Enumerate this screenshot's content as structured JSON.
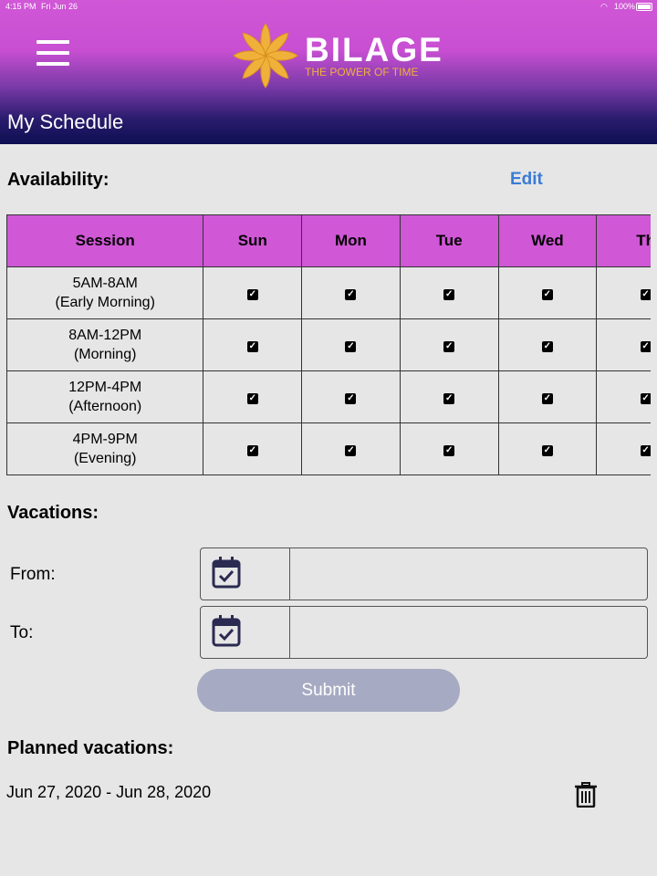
{
  "status_bar": {
    "time": "4:15 PM",
    "date": "Fri Jun 26",
    "battery": "100%"
  },
  "header": {
    "brand_name": "BILAGE",
    "brand_tagline": "THE POWER OF TIME",
    "page_title": "My Schedule",
    "menu_icon": "hamburger-icon"
  },
  "colors": {
    "header_top": "#d057d6",
    "header_bottom": "#0e0f52",
    "table_header": "#d057d6",
    "edit_link": "#3a7bd5",
    "submit_disabled": "#a6aac2",
    "brand_gold": "#f0b13a"
  },
  "availability": {
    "title": "Availability:",
    "edit_label": "Edit",
    "columns": [
      "Session",
      "Sun",
      "Mon",
      "Tue",
      "Wed",
      "Th"
    ],
    "rows": [
      {
        "line1": "5AM-8AM",
        "line2": "(Early Morning)",
        "checked": [
          true,
          true,
          true,
          true,
          true
        ]
      },
      {
        "line1": "8AM-12PM",
        "line2": "(Morning)",
        "checked": [
          true,
          true,
          true,
          true,
          true
        ]
      },
      {
        "line1": "12PM-4PM",
        "line2": "(Afternoon)",
        "checked": [
          true,
          true,
          true,
          true,
          true
        ]
      },
      {
        "line1": "4PM-9PM",
        "line2": "(Evening)",
        "checked": [
          true,
          true,
          true,
          true,
          true
        ]
      }
    ]
  },
  "vacations": {
    "title": "Vacations:",
    "from_label": "From:",
    "to_label": "To:",
    "from_value": "",
    "to_value": "",
    "calendar_icon": "calendar-check-icon",
    "submit_label": "Submit"
  },
  "planned": {
    "title": "Planned vacations:",
    "items": [
      {
        "range": "Jun 27, 2020 - Jun 28, 2020",
        "delete_icon": "trash-icon"
      }
    ]
  }
}
